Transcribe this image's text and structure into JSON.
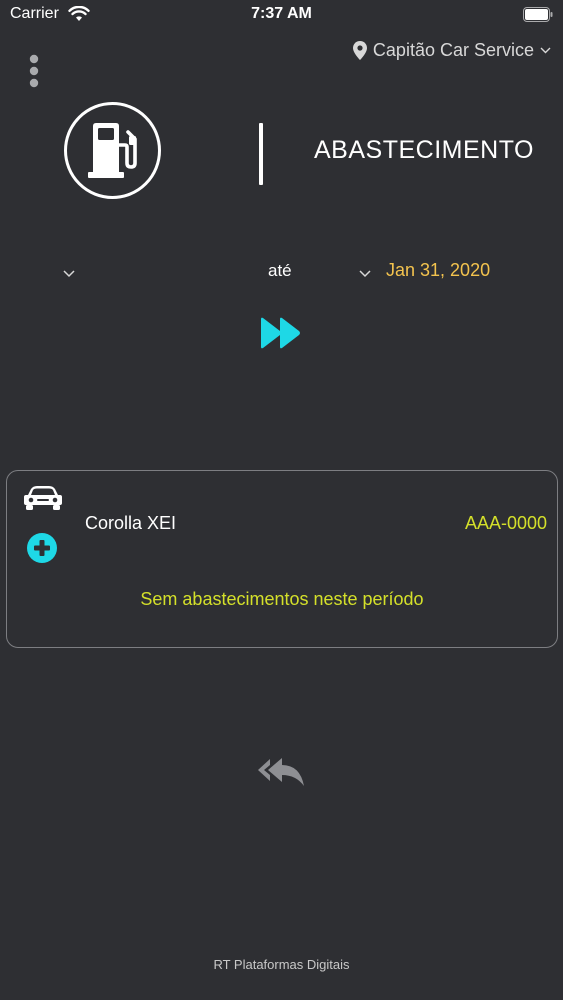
{
  "status_bar": {
    "carrier": "Carrier",
    "time": "7:37 AM"
  },
  "header": {
    "location": "Capitão Car Service",
    "title": "ABASTECIMENTO"
  },
  "date_range": {
    "start_value": "",
    "until_label": "até",
    "end_value": "Jan 31, 2020"
  },
  "vehicle": {
    "name": "Corolla XEI",
    "plate": "AAA-0000",
    "empty_message": "Sem abastecimentos neste período"
  },
  "footer": {
    "text": "RT Plataformas Digitais"
  },
  "colors": {
    "background": "#2e2f33",
    "accent": "#1ed8e6",
    "date_highlight": "#f3c34e",
    "plate_text": "#d4e02a"
  },
  "icons": {
    "menu": "vertical-dots-icon",
    "location": "location-pin-icon",
    "fuel": "fuel-pump-icon",
    "forward": "fast-forward-icon",
    "car": "car-icon",
    "add": "plus-circle-icon",
    "back": "reply-all-icon"
  }
}
